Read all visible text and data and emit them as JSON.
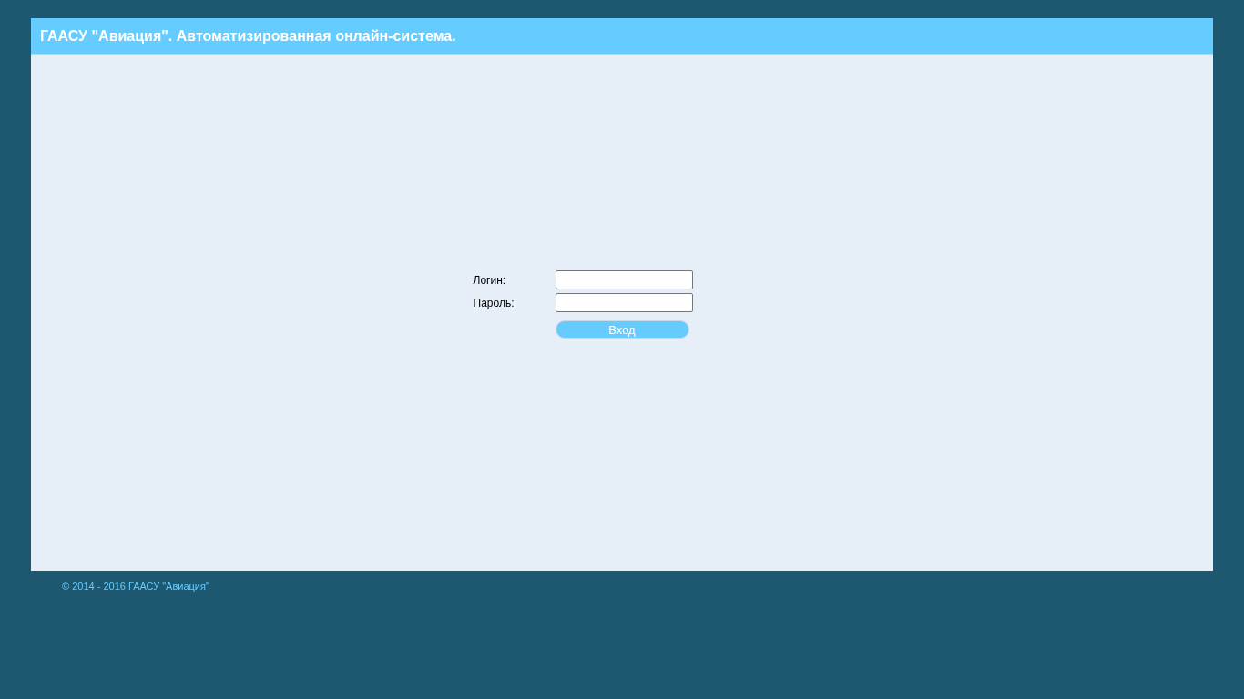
{
  "header": {
    "title": "ГААСУ \"Авиация\". Автоматизированная онлайн-система."
  },
  "form": {
    "fields": [
      {
        "label": "Логин:"
      },
      {
        "label": "Пароль:"
      }
    ],
    "submit": "Вход"
  },
  "footer": {
    "copyright": "© 2014 - 2016 ГААСУ \"Авиация\""
  }
}
